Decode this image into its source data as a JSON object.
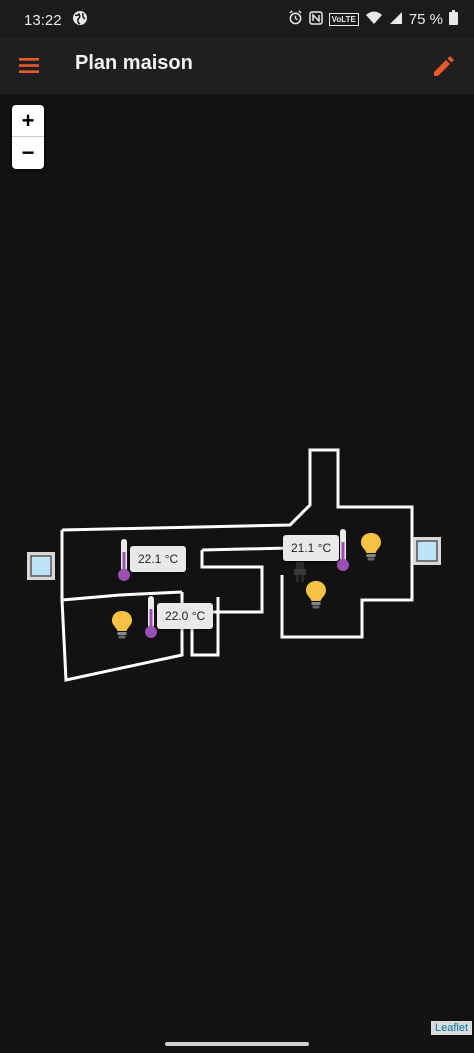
{
  "status_bar": {
    "time": "13:22",
    "battery_percent": "75 %",
    "network": "VoLTE",
    "icons": [
      "globe-icon",
      "alarm-icon",
      "nfc-icon",
      "volte-icon",
      "wifi-icon",
      "signal-icon",
      "battery-icon"
    ]
  },
  "app_bar": {
    "title": "Plan maison",
    "menu_icon": "hamburger-menu-icon",
    "edit_icon": "pencil-edit-icon",
    "accent_color": "#e8592b"
  },
  "map": {
    "zoom_in": "+",
    "zoom_out": "−",
    "attribution": "Leaflet",
    "sensors": [
      {
        "name": "temp-sensor-1",
        "value": "22.1 °C"
      },
      {
        "name": "temp-sensor-2",
        "value": "22.0 °C"
      },
      {
        "name": "temp-sensor-3",
        "value": "21.1 °C"
      }
    ],
    "lights": [
      "bulb-icon",
      "bulb-icon",
      "bulb-icon"
    ],
    "windows": [
      "window-icon",
      "window-icon"
    ],
    "colors": {
      "wall": "#ffffff",
      "bulb": "#f7c143",
      "thermometer": "#9c4fb5"
    }
  }
}
